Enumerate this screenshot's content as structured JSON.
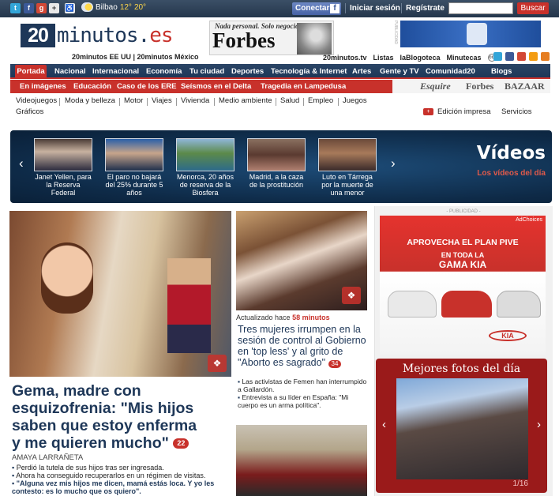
{
  "topbar": {
    "weather_city": "Bilbao",
    "temp_low": "12°",
    "temp_high": "20°",
    "connect_label": "Conectar",
    "login_label": "Iniciar sesión",
    "register_label": "Regístrate",
    "search_value": "",
    "search_button": "Buscar",
    "icons": [
      "twitter-icon",
      "facebook-icon",
      "google-plus-icon",
      "plus-icon",
      "accessibility-icon"
    ]
  },
  "header": {
    "logo_main": "20",
    "logo_text": "minutos",
    "logo_tld": "es",
    "editions": "20minutos EE UU | 20minutos México",
    "forbes_tagline": "Nada personal. Solo negocios",
    "forbes_name": "Forbes",
    "pub_label": "PUBLICIDAD",
    "links": [
      "20minutos.tv",
      "Listas",
      "laBlogoteca",
      "Minutecas"
    ],
    "rss": "cc"
  },
  "nav_main": {
    "active": "Portada",
    "items": [
      "Nacional",
      "Internacional",
      "Economía",
      "Tu ciudad",
      "Deportes",
      "Tecnología & Internet",
      "Artes",
      "Gente y TV",
      "Comunidad20",
      "Blogs"
    ]
  },
  "nav_topics": {
    "items": [
      "En imágenes",
      "Educación",
      "Caso de los ERE",
      "Seísmos en el Delta",
      "Tragedia en Lampedusa"
    ],
    "brands": [
      "Esquire",
      "Forbes",
      "BAZAAR"
    ]
  },
  "nav_sections": {
    "items": [
      "Videojuegos",
      "Moda y belleza",
      "Motor",
      "Viajes",
      "Vivienda",
      "Medio ambiente",
      "Salud",
      "Empleo",
      "Juegos",
      "Gráficos"
    ],
    "print_edition": "Edición impresa",
    "services": "Servicios"
  },
  "videos": {
    "title": "Vídeos",
    "subtitle": "Los vídeos del día",
    "items": [
      {
        "caption": "Janet Yellen, para la Reserva Federal"
      },
      {
        "caption": "El paro no bajará del 25% durante 5 años"
      },
      {
        "caption": "Menorca, 20 años de reserva de la Biosfera"
      },
      {
        "caption": "Madrid, a la caza de la prostitución"
      },
      {
        "caption": "Luto en Tárrega por la muerte de una menor"
      }
    ]
  },
  "lead": {
    "headline": "Gema, madre con esquizofrenia: \"Mis hijos saben que estoy enferma y me quieren mucho\"",
    "comments": "22",
    "author": "Amaya Larrañeta",
    "bullets": [
      "Perdió la tutela de sus hijos tras ser ingresada.",
      "Ahora ha conseguido recuperarlos en un régimen de visitas.",
      "\"Alguna vez mis hijos me dicen, mamá estás loca. Y yo les contesto: es lo mucho que os quiero\"."
    ]
  },
  "mid": {
    "updated_prefix": "Actualizado hace",
    "updated_value": "58 minutos",
    "headline": "Tres mujeres irrumpen en la sesión de control al Gobierno en 'top less' y al grito de \"Aborto es sagrado\"",
    "comments": "34",
    "bullets": [
      "Las activistas de Femen han interrumpido a Gallardón.",
      "Entrevista a su líder en España: \"Mi cuerpo es un arma política\"."
    ]
  },
  "right": {
    "pub_label": "- PUBLICIDAD -",
    "ad_choices": "AdChoices",
    "ad_line1": "APROVECHA EL PLAN PIVE",
    "ad_line2": "EN TODA LA",
    "ad_line3": "GAMA KIA",
    "ad_logo": "KIA",
    "photos_title": "Mejores fotos del día",
    "photos_counter": "1/16"
  }
}
